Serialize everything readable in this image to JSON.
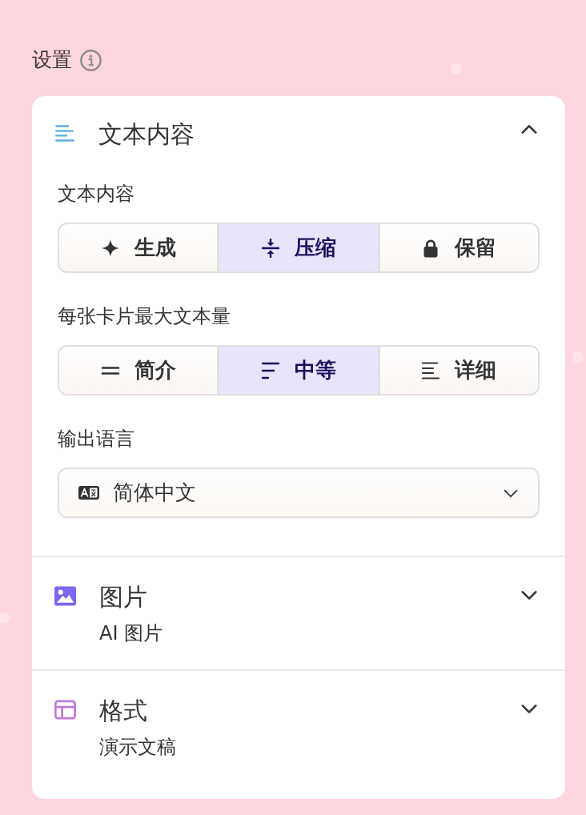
{
  "title": "设置",
  "sections": [
    {
      "kind": "text",
      "title": "文本内容",
      "expanded": true,
      "fields": [
        {
          "kind": "segmented",
          "label": "文本内容",
          "options": [
            {
              "kind": "generate",
              "label": "生成",
              "selected": false
            },
            {
              "kind": "condense",
              "label": "压缩",
              "selected": true
            },
            {
              "kind": "preserve",
              "label": "保留",
              "selected": false
            }
          ]
        },
        {
          "kind": "segmented",
          "label": "每张卡片最大文本量",
          "options": [
            {
              "kind": "brief",
              "label": "简介",
              "selected": false
            },
            {
              "kind": "medium",
              "label": "中等",
              "selected": true
            },
            {
              "kind": "detailed",
              "label": "详细",
              "selected": false
            }
          ]
        },
        {
          "kind": "dropdown",
          "label": "输出语言",
          "value": "简体中文"
        }
      ]
    },
    {
      "kind": "image",
      "title": "图片",
      "subtitle": "AI 图片",
      "expanded": false
    },
    {
      "kind": "format",
      "title": "格式",
      "subtitle": "演示文稿",
      "expanded": false
    }
  ]
}
